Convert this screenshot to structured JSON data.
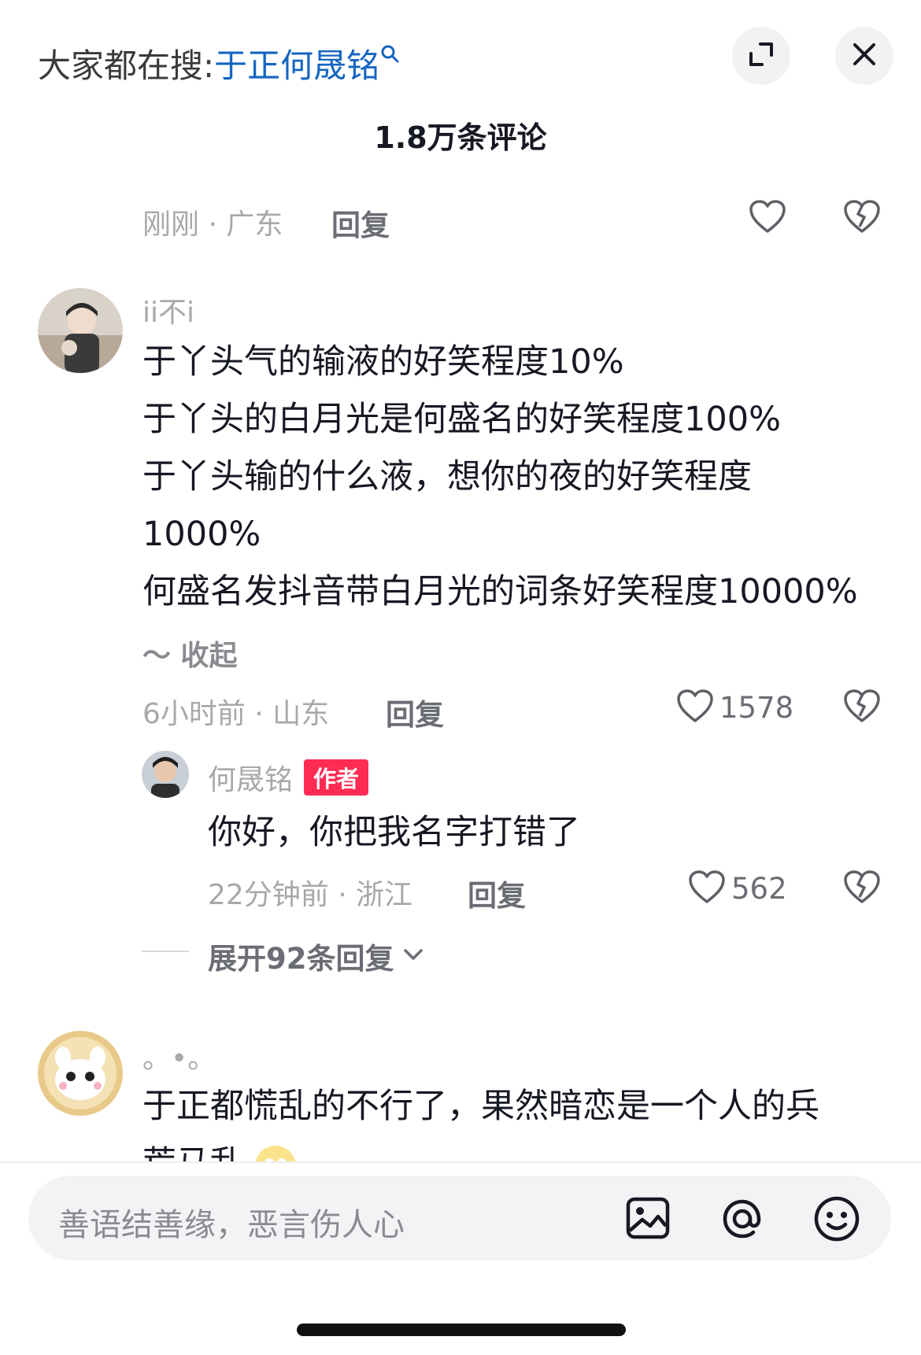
{
  "header": {
    "search_prefix": "大家都在搜:",
    "search_term": "于正何晟铭",
    "title": "1.8万条评论"
  },
  "icons": {
    "expand": "expand-icon",
    "close": "close-icon",
    "like": "heart-outline-icon",
    "dislike": "broken-heart-icon",
    "image": "image-icon",
    "at": "at-icon",
    "emoji": "emoji-icon"
  },
  "comments": [
    {
      "time_location": "刚刚 · 广东",
      "reply_label": "回复"
    },
    {
      "username": "ii不i",
      "lines": [
        "于丫头气的输液的好笑程度10%",
        "于丫头的白月光是何盛名的好笑程度100%",
        "于丫头输的什么液，想你的夜的好笑程度",
        "1000%",
        "何盛名发抖音带白月光的词条好笑程度10000%"
      ],
      "collapse_label": "～ 收起",
      "time_location": "6小时前 · 山东",
      "reply_label": "回复",
      "like_count": "1578",
      "reply": {
        "username": "何晟铭",
        "badge": "作者",
        "text": "你好，你把我名字打错了",
        "time_location": "22分钟前 · 浙江",
        "reply_label": "回复",
        "like_count": "562"
      },
      "expand_label": "展开92条回复"
    },
    {
      "username": "。•。",
      "lines": [
        "于正都慌乱的不行了，果然暗恋是一个人的兵",
        "荒马乱"
      ]
    }
  ],
  "input": {
    "placeholder": "善语结善缘，恶言伤人心"
  },
  "colors": {
    "accent_blue": "#1565c0",
    "author_badge": "#fe2c55",
    "meta_gray": "#a7a8ac"
  }
}
